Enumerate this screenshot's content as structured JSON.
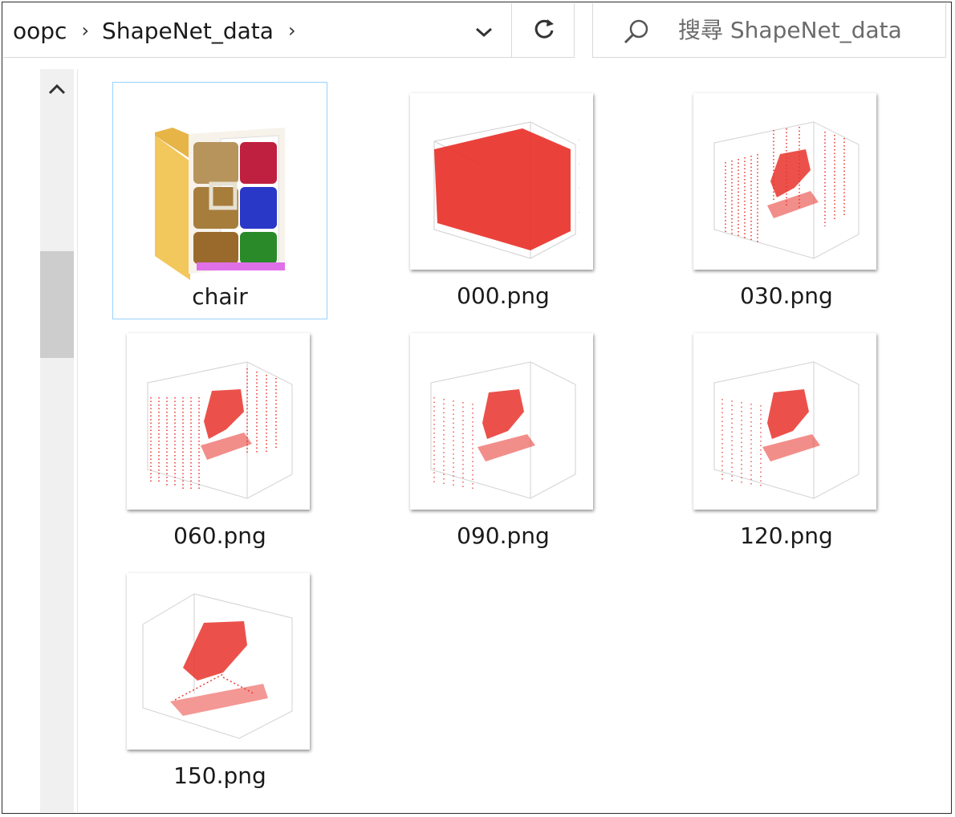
{
  "breadcrumb": [
    "oopc",
    "ShapeNet_data"
  ],
  "search": {
    "placeholder": "搜尋 ShapeNet_data"
  },
  "items": [
    {
      "label": "chair",
      "type": "folder",
      "selected": true
    },
    {
      "label": "000.png",
      "type": "image",
      "kind": "cube"
    },
    {
      "label": "030.png",
      "type": "image",
      "kind": "chair-grid"
    },
    {
      "label": "060.png",
      "type": "image",
      "kind": "chair-grid"
    },
    {
      "label": "090.png",
      "type": "image",
      "kind": "chair-grid"
    },
    {
      "label": "120.png",
      "type": "image",
      "kind": "chair-grid"
    },
    {
      "label": "150.png",
      "type": "image",
      "kind": "chair"
    }
  ],
  "colors": {
    "accent_selection": "#99d1ff",
    "plot_points": "#e8322a"
  },
  "icons": {
    "chevron": "chevron-right-icon",
    "dropdown": "chevron-down-icon",
    "refresh": "refresh-icon",
    "search": "search-icon",
    "scroll_up": "chevron-up-icon"
  }
}
